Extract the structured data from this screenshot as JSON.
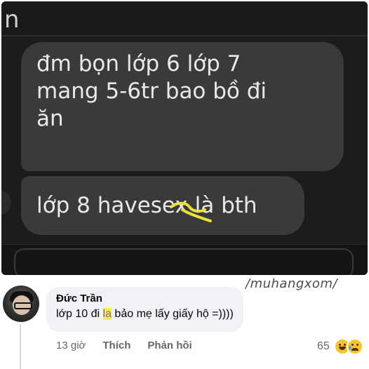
{
  "screenshot": {
    "header_glyph": " n",
    "messages": [
      "đm bọn lớp 6 lớp 7\nmang 5-6tr bao bồ đi\năn",
      "lớp 8 havesex là bth"
    ]
  },
  "watermark": "/muhangxom/",
  "comment": {
    "author": "Đức Trần",
    "text_before": "lớp 10 đi ",
    "text_highlight": "la",
    "text_after": " bảo mẹ lấy giấy hộ =))))",
    "time": "13 giờ",
    "like_label": "Thích",
    "reply_label": "Phản hồi",
    "reaction_count": "65",
    "reactions": [
      "haha-icon",
      "sad-icon"
    ]
  },
  "colors": {
    "chat_bg": "#1c1c1e",
    "bubble_bg": "#3a3a3c",
    "highlight": "#f7ec4b",
    "comment_bg": "#f0f2f5"
  }
}
